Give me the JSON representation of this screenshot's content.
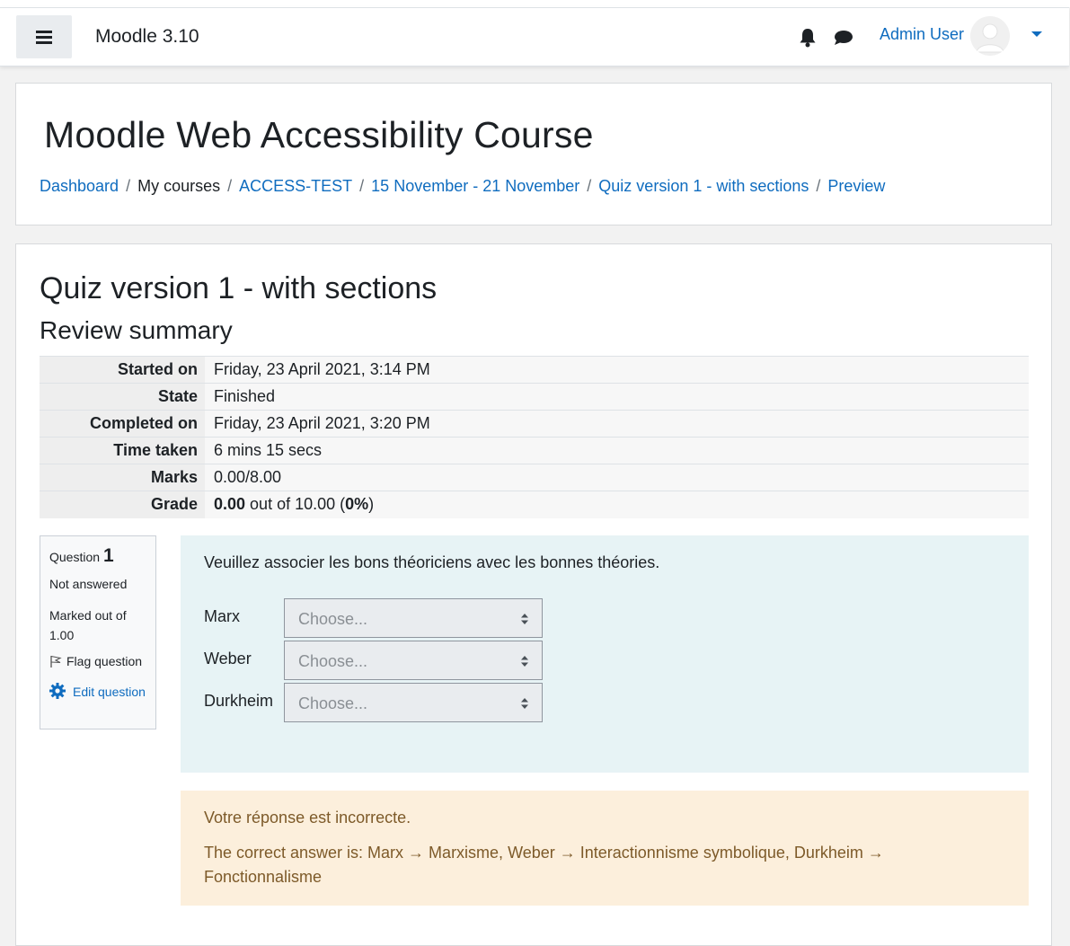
{
  "navbar": {
    "site_name": "Moodle 3.10",
    "user_name": "Admin User"
  },
  "header": {
    "course_title": "Moodle Web Accessibility Course",
    "breadcrumb": [
      {
        "label": "Dashboard",
        "link": true
      },
      {
        "label": "My courses",
        "link": false
      },
      {
        "label": "ACCESS-TEST",
        "link": true
      },
      {
        "label": "15 November - 21 November",
        "link": true
      },
      {
        "label": "Quiz version 1 - with sections",
        "link": true
      },
      {
        "label": "Preview",
        "link": true
      }
    ],
    "separator": "/"
  },
  "main": {
    "quiz_title": "Quiz version 1 - with sections",
    "review_heading": "Review summary",
    "summary": [
      {
        "label": "Started on",
        "value": "Friday, 23 April 2021, 3:14 PM"
      },
      {
        "label": "State",
        "value": "Finished"
      },
      {
        "label": "Completed on",
        "value": "Friday, 23 April 2021, 3:20 PM"
      },
      {
        "label": "Time taken",
        "value": "6 mins 15 secs"
      },
      {
        "label": "Marks",
        "value": "0.00/8.00"
      }
    ],
    "grade": {
      "label": "Grade",
      "score": "0.00",
      "out_of_text": " out of 10.00 (",
      "percent": "0%",
      "close": ")"
    }
  },
  "question": {
    "info": {
      "question_label": "Question",
      "number": "1",
      "state": "Not answered",
      "grade": "Marked out of 1.00",
      "flag": "Flag question",
      "edit": "Edit question"
    },
    "text": "Veuillez associer les bons théoriciens avec les bonnes théories.",
    "rows": [
      {
        "stem": "Marx",
        "selected": "Choose..."
      },
      {
        "stem": "Weber",
        "selected": "Choose..."
      },
      {
        "stem": "Durkheim",
        "selected": "Choose..."
      }
    ],
    "feedback": "Votre réponse est incorrecte.",
    "right_answer": "The correct answer is: Marx → Marxisme, Weber → Interactionnisme symbolique, Durkheim → Fonctionnalisme"
  },
  "colors": {
    "link": "#0f6cbf",
    "formulation_bg": "#e7f3f5",
    "outcome_bg": "#fcefdc",
    "outcome_text": "#7d5a29"
  },
  "icons": [
    "menu-icon",
    "bell-icon",
    "chat-icon",
    "avatar-icon",
    "caret-down-icon",
    "flag-icon",
    "gear-icon",
    "select-arrows-icon"
  ]
}
